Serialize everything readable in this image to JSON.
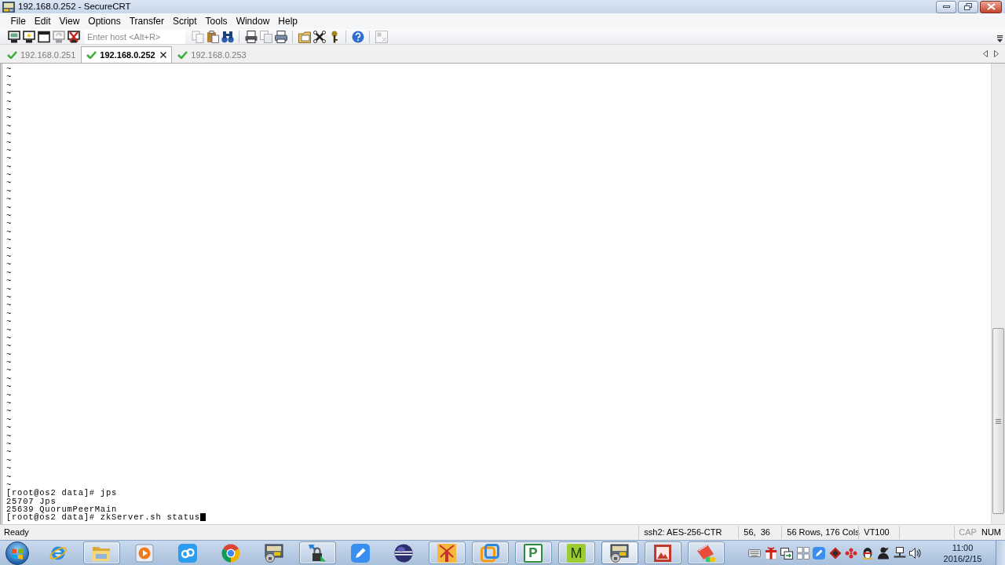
{
  "window": {
    "title": "192.168.0.252 - SecureCRT"
  },
  "menu": [
    "File",
    "Edit",
    "View",
    "Options",
    "Transfer",
    "Script",
    "Tools",
    "Window",
    "Help"
  ],
  "toolbar": {
    "items": [
      {
        "kind": "monitor",
        "disabled": false
      },
      {
        "kind": "monitor-bolt",
        "disabled": false
      },
      {
        "kind": "window",
        "disabled": false
      },
      {
        "kind": "monitor-arrow",
        "disabled": true
      },
      {
        "kind": "monitor-cross",
        "disabled": false
      },
      {
        "kind": "host-field",
        "placeholder": "Enter host <Alt+R>"
      },
      {
        "kind": "copy",
        "disabled": true
      },
      {
        "kind": "paste",
        "disabled": false
      },
      {
        "kind": "find",
        "disabled": false
      },
      {
        "kind": "separator"
      },
      {
        "kind": "print-page",
        "disabled": false
      },
      {
        "kind": "print-screen",
        "disabled": true
      },
      {
        "kind": "print",
        "disabled": false
      },
      {
        "kind": "separator"
      },
      {
        "kind": "options",
        "disabled": false
      },
      {
        "kind": "tools",
        "disabled": false
      },
      {
        "kind": "key",
        "disabled": false
      },
      {
        "kind": "separator"
      },
      {
        "kind": "help",
        "disabled": false
      },
      {
        "kind": "separator"
      },
      {
        "kind": "layout",
        "disabled": true
      }
    ]
  },
  "tabs": [
    {
      "label": "192.168.0.251",
      "selected": false,
      "connected": true
    },
    {
      "label": "192.168.0.252",
      "selected": true,
      "connected": true
    },
    {
      "label": "192.168.0.253",
      "selected": false,
      "connected": true
    }
  ],
  "terminal": {
    "lines": [
      "~",
      "~",
      "~",
      "~",
      "~",
      "~",
      "~",
      "~",
      "~",
      "~",
      "~",
      "~",
      "~",
      "~",
      "~",
      "~",
      "~",
      "~",
      "~",
      "~",
      "~",
      "~",
      "~",
      "~",
      "~",
      "~",
      "~",
      "~",
      "~",
      "~",
      "~",
      "~",
      "~",
      "~",
      "~",
      "~",
      "~",
      "~",
      "~",
      "~",
      "~",
      "~",
      "~",
      "~",
      "~",
      "~",
      "~",
      "~",
      "~",
      "~",
      "~",
      "~",
      "[root@os2 data]# jps",
      "25707 Jps",
      "25639 QuorumPeerMain",
      "[root@os2 data]# zkServer.sh status"
    ],
    "cursor": true
  },
  "status_bar": {
    "message": "Ready",
    "cipher": "ssh2: AES-256-CTR",
    "position": "56,  36",
    "size": "56 Rows, 176 Cols",
    "emulation": "VT100",
    "keys": [
      {
        "label": "CAP",
        "on": false
      },
      {
        "label": "NUM",
        "on": true
      }
    ]
  },
  "taskbar": {
    "items": [
      {
        "kind": "globe",
        "running": false,
        "selected": false
      },
      {
        "kind": "folder",
        "running": true,
        "selected": false
      },
      {
        "kind": "player",
        "running": false,
        "selected": false
      },
      {
        "kind": "cloud",
        "running": false,
        "selected": false
      },
      {
        "kind": "wheel",
        "running": false,
        "selected": false
      },
      {
        "kind": "screen-lock",
        "running": false,
        "selected": false
      },
      {
        "kind": "padlock",
        "running": true,
        "selected": false
      },
      {
        "kind": "pen",
        "running": false,
        "selected": false
      },
      {
        "kind": "sphere",
        "running": false,
        "selected": false
      },
      {
        "kind": "windmill",
        "running": true,
        "selected": false
      },
      {
        "kind": "squares",
        "running": true,
        "selected": false
      },
      {
        "kind": "letter-tile",
        "letter": "P",
        "running": true,
        "selected": false
      },
      {
        "kind": "letter-block",
        "letter": "M",
        "running": true,
        "selected": false
      },
      {
        "kind": "screen-lock",
        "running": true,
        "selected": true
      },
      {
        "kind": "picture",
        "running": true,
        "selected": false
      },
      {
        "kind": "notepad",
        "running": true,
        "selected": false
      }
    ],
    "clock": {
      "time": "11:00",
      "date": "2016/2/15"
    }
  }
}
